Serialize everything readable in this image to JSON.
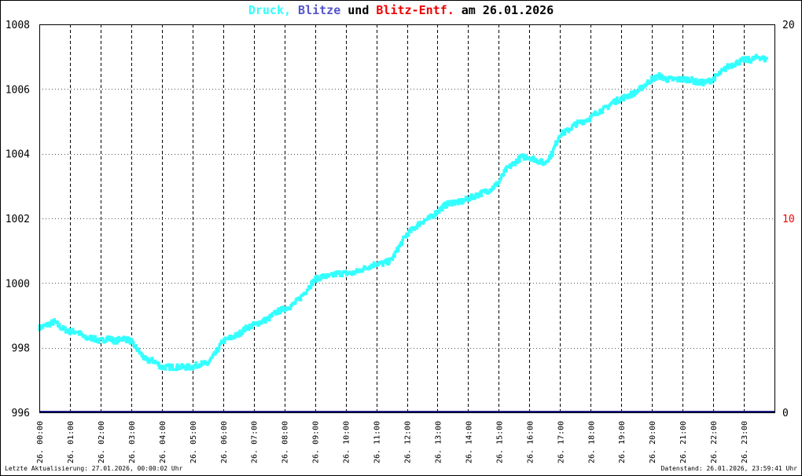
{
  "title": {
    "parts": [
      {
        "text": "Druck,",
        "color": "#33ffff"
      },
      {
        "text": " ",
        "color": "#000000"
      },
      {
        "text": "Blitze",
        "color": "#5555cc"
      },
      {
        "text": " und ",
        "color": "#000000"
      },
      {
        "text": "Blitz-Entf.",
        "color": "#ee0000"
      },
      {
        "text": " am 26.01.2026",
        "color": "#000000"
      }
    ]
  },
  "footer": {
    "left": "Letzte Aktualisierung: 27.01.2026, 00:00:02 Uhr",
    "right": "Datenstand: 26.01.2026, 23:59:41 Uhr"
  },
  "colors": {
    "pressure": "#33ffff",
    "lightning": "#1a1a80",
    "right_axis": "#ee0000",
    "grid": "#000000"
  },
  "chart_data": {
    "type": "line",
    "x_unit": "hours",
    "xlim": [
      0,
      24
    ],
    "ylim_left": [
      996,
      1008
    ],
    "yticks_left": [
      "996",
      "998",
      "1000",
      "1002",
      "1004",
      "1006",
      "1008"
    ],
    "ylim_right": [
      0,
      20
    ],
    "yticks_right": [
      "0",
      "10",
      "20"
    ],
    "xtick_labels": [
      "26. 00:00",
      "26. 01:00",
      "26. 02:00",
      "26. 03:00",
      "26. 04:00",
      "26. 05:00",
      "26. 06:00",
      "26. 07:00",
      "26. 08:00",
      "26. 09:00",
      "26. 10:00",
      "26. 11:00",
      "26. 12:00",
      "26. 13:00",
      "26. 14:00",
      "26. 15:00",
      "26. 16:00",
      "26. 17:00",
      "26. 18:00",
      "26. 19:00",
      "26. 20:00",
      "26. 21:00",
      "26. 22:00",
      "26. 23:00"
    ],
    "grid": true,
    "series": [
      {
        "name": "Druck",
        "axis": "left",
        "points": [
          [
            0.0,
            998.6
          ],
          [
            0.25,
            998.7
          ],
          [
            0.5,
            998.8
          ],
          [
            0.75,
            998.6
          ],
          [
            1.0,
            998.5
          ],
          [
            1.25,
            998.5
          ],
          [
            1.5,
            998.3
          ],
          [
            1.75,
            998.3
          ],
          [
            2.0,
            998.2
          ],
          [
            2.25,
            998.3
          ],
          [
            2.5,
            998.2
          ],
          [
            2.75,
            998.3
          ],
          [
            3.0,
            998.2
          ],
          [
            3.25,
            997.9
          ],
          [
            3.5,
            997.6
          ],
          [
            3.75,
            997.6
          ],
          [
            4.0,
            997.4
          ],
          [
            4.25,
            997.4
          ],
          [
            4.5,
            997.4
          ],
          [
            4.75,
            997.4
          ],
          [
            5.0,
            997.4
          ],
          [
            5.25,
            997.5
          ],
          [
            5.5,
            997.5
          ],
          [
            5.75,
            997.8
          ],
          [
            6.0,
            998.2
          ],
          [
            6.25,
            998.3
          ],
          [
            6.5,
            998.4
          ],
          [
            6.75,
            998.6
          ],
          [
            7.0,
            998.7
          ],
          [
            7.25,
            998.8
          ],
          [
            7.5,
            998.9
          ],
          [
            7.75,
            999.1
          ],
          [
            8.0,
            999.2
          ],
          [
            8.25,
            999.3
          ],
          [
            8.5,
            999.5
          ],
          [
            8.75,
            999.8
          ],
          [
            9.0,
            1000.1
          ],
          [
            9.25,
            1000.2
          ],
          [
            9.5,
            1000.2
          ],
          [
            9.75,
            1000.3
          ],
          [
            10.0,
            1000.3
          ],
          [
            10.25,
            1000.3
          ],
          [
            10.5,
            1000.4
          ],
          [
            10.75,
            1000.5
          ],
          [
            11.0,
            1000.6
          ],
          [
            11.25,
            1000.6
          ],
          [
            11.5,
            1000.7
          ],
          [
            11.75,
            1001.1
          ],
          [
            12.0,
            1001.5
          ],
          [
            12.25,
            1001.7
          ],
          [
            12.5,
            1001.9
          ],
          [
            12.75,
            1002.0
          ],
          [
            13.0,
            1002.2
          ],
          [
            13.25,
            1002.4
          ],
          [
            13.5,
            1002.5
          ],
          [
            13.75,
            1002.5
          ],
          [
            14.0,
            1002.6
          ],
          [
            14.25,
            1002.7
          ],
          [
            14.5,
            1002.8
          ],
          [
            14.75,
            1002.9
          ],
          [
            15.0,
            1003.1
          ],
          [
            15.25,
            1003.5
          ],
          [
            15.5,
            1003.7
          ],
          [
            15.75,
            1003.9
          ],
          [
            16.0,
            1003.9
          ],
          [
            16.25,
            1003.8
          ],
          [
            16.5,
            1003.7
          ],
          [
            16.75,
            1004.0
          ],
          [
            17.0,
            1004.6
          ],
          [
            17.25,
            1004.7
          ],
          [
            17.5,
            1004.9
          ],
          [
            17.75,
            1005.0
          ],
          [
            18.0,
            1005.1
          ],
          [
            18.25,
            1005.3
          ],
          [
            18.5,
            1005.4
          ],
          [
            18.75,
            1005.6
          ],
          [
            19.0,
            1005.7
          ],
          [
            19.25,
            1005.8
          ],
          [
            19.5,
            1005.9
          ],
          [
            19.75,
            1006.1
          ],
          [
            20.0,
            1006.3
          ],
          [
            20.25,
            1006.4
          ],
          [
            20.5,
            1006.3
          ],
          [
            20.75,
            1006.3
          ],
          [
            21.0,
            1006.3
          ],
          [
            21.25,
            1006.3
          ],
          [
            21.5,
            1006.2
          ],
          [
            21.75,
            1006.2
          ],
          [
            22.0,
            1006.3
          ],
          [
            22.25,
            1006.5
          ],
          [
            22.5,
            1006.7
          ],
          [
            22.75,
            1006.8
          ],
          [
            23.0,
            1006.9
          ],
          [
            23.25,
            1006.9
          ],
          [
            23.5,
            1007.0
          ],
          [
            23.75,
            1006.9
          ]
        ]
      },
      {
        "name": "Blitze",
        "axis": "right",
        "points": [
          [
            0,
            0
          ],
          [
            24,
            0
          ]
        ]
      }
    ]
  }
}
